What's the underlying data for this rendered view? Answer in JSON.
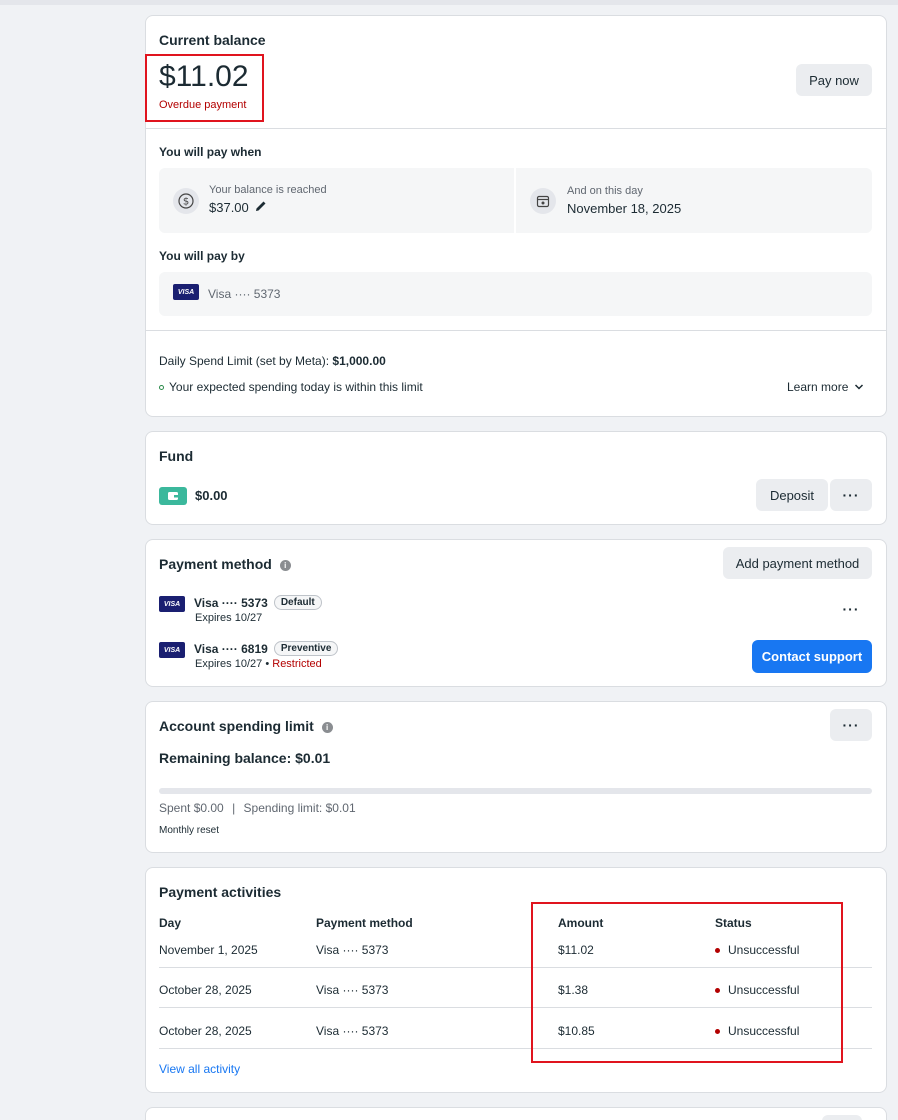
{
  "balance": {
    "title": "Current balance",
    "amount": "$11.02",
    "status": "Overdue payment",
    "pay_now_label": "Pay now",
    "pay_when_title": "You will pay when",
    "threshold_label": "Your balance is reached",
    "threshold_value": "$37.00",
    "date_label": "And on this day",
    "date_value": "November 18, 2025",
    "pay_by_title": "You will pay by",
    "pay_by_card": "Visa ···· 5373",
    "daily_limit_label": "Daily Spend Limit (set by Meta): ",
    "daily_limit_value": "$1,000.00",
    "daily_limit_note": "Your expected spending today is within this limit",
    "learn_more": "Learn more"
  },
  "fund": {
    "title": "Fund",
    "amount": "$0.00",
    "deposit_label": "Deposit"
  },
  "payment_method": {
    "title": "Payment method",
    "add_label": "Add payment method",
    "cards": [
      {
        "name": "Visa ···· 5373",
        "badge": "Default",
        "expires": "Expires 10/27",
        "extra": ""
      },
      {
        "name": "Visa ···· 6819",
        "badge": "Preventive",
        "expires": "Expires 10/27",
        "extra": "Restricted"
      }
    ],
    "contact_label": "Contact support"
  },
  "spending_limit": {
    "title": "Account spending limit",
    "remaining": "Remaining balance: $0.01",
    "spent": "Spent $0.00",
    "limit": "Spending limit: $0.01",
    "reset": "Monthly reset",
    "progress_fraction": 0
  },
  "activities": {
    "title": "Payment activities",
    "columns": [
      "Day",
      "Payment method",
      "Amount",
      "Status"
    ],
    "rows": [
      {
        "day": "November 1, 2025",
        "method": "Visa ···· 5373",
        "amount": "$11.02",
        "status": "Unsuccessful"
      },
      {
        "day": "October 28, 2025",
        "method": "Visa ···· 5373",
        "amount": "$1.38",
        "status": "Unsuccessful"
      },
      {
        "day": "October 28, 2025",
        "method": "Visa ···· 5373",
        "amount": "$10.85",
        "status": "Unsuccessful"
      }
    ],
    "view_all": "View all activity"
  },
  "icons": {
    "dollar": "dollar-circle-icon",
    "calendar": "calendar-icon",
    "edit": "pencil-icon",
    "wallet": "wallet-icon",
    "more": "more-dots-icon",
    "info": "info-icon",
    "chevron": "chevron-down-icon"
  },
  "colors": {
    "accent": "#1877f2",
    "error": "#b30000",
    "annotation": "#e0141e",
    "fund_icon": "#3bb89c"
  }
}
